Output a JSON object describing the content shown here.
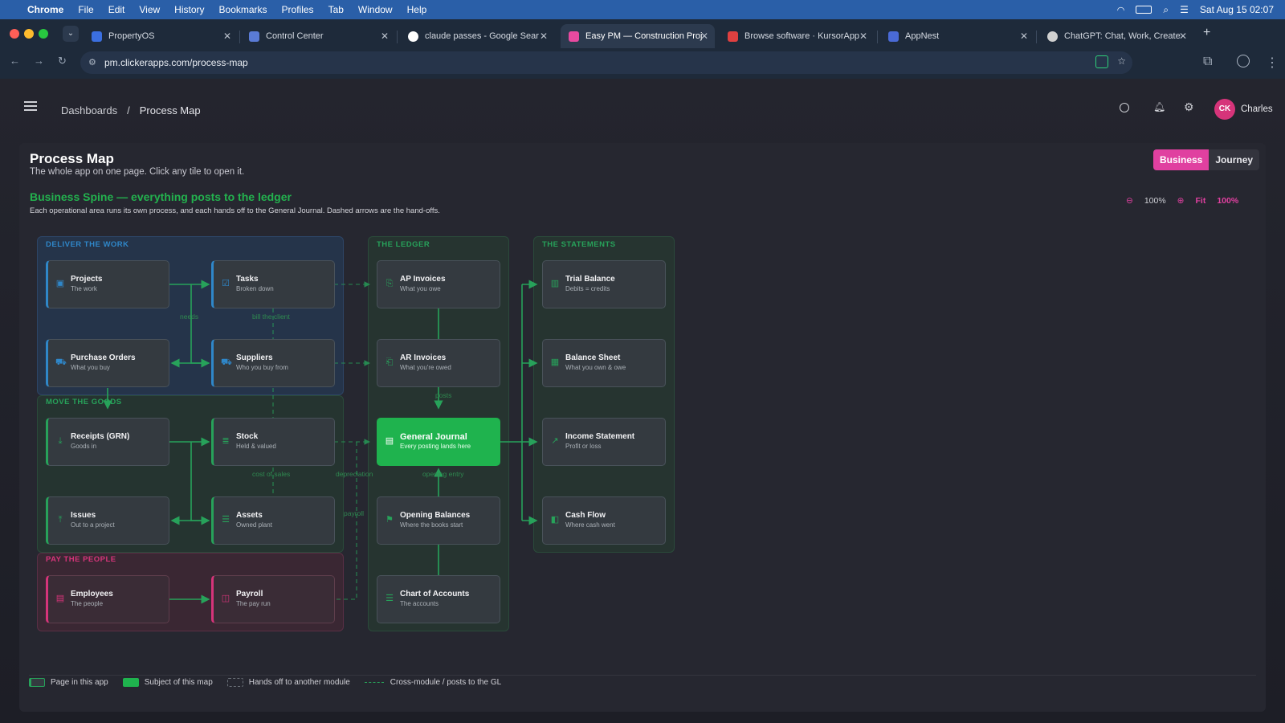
{
  "menubar": {
    "app": "Chrome",
    "items": [
      "File",
      "Edit",
      "View",
      "History",
      "Bookmarks",
      "Profiles",
      "Tab",
      "Window",
      "Help"
    ],
    "clock": "Sat Aug 15  02:07"
  },
  "tabs": [
    {
      "title": "PropertyOS",
      "color": "#3b6fe0"
    },
    {
      "title": "Control Center",
      "color": "#5a7bd6"
    },
    {
      "title": "claude passes - Google Sear",
      "color": "#ffffff"
    },
    {
      "title": "Easy PM — Construction Proj",
      "color": "#e84aa0"
    },
    {
      "title": "Browse software · KursorApp",
      "color": "#e04040"
    },
    {
      "title": "AppNest",
      "color": "#4a6ad6"
    },
    {
      "title": "ChatGPT: Chat, Work, Create",
      "color": "#d0d0d0"
    }
  ],
  "address": "pm.clickerapps.com/process-map",
  "breadcrumb": {
    "root": "Dashboards",
    "sep": "/",
    "current": "Process Map"
  },
  "user": {
    "initials": "CK",
    "name": "Charles",
    "avatar_color": "#d6347a"
  },
  "page": {
    "title": "Process Map",
    "subtitle": "The whole app on one page. Click any tile to open it.",
    "toggle": [
      "Business",
      "Journey"
    ],
    "active_toggle": "Business",
    "section_title": "Business Spine — everything posts to the ledger",
    "section_desc": "Each operational area runs its own process, and each hands off to the General Journal. Dashed arrows are the hand-offs.",
    "zoom": "100%",
    "fit": "Fit",
    "zoom2": "100%"
  },
  "groups": {
    "deliver": "DELIVER THE WORK",
    "move": "MOVE THE GOODS",
    "pay": "PAY THE PEOPLE",
    "ledger": "THE LEDGER",
    "statements": "THE STATEMENTS"
  },
  "tiles": {
    "projects": {
      "title": "Projects",
      "sub": "The work"
    },
    "tasks": {
      "title": "Tasks",
      "sub": "Broken down"
    },
    "purchase_orders": {
      "title": "Purchase Orders",
      "sub": "What you buy"
    },
    "suppliers": {
      "title": "Suppliers",
      "sub": "Who you buy from"
    },
    "receipts": {
      "title": "Receipts (GRN)",
      "sub": "Goods in"
    },
    "stock": {
      "title": "Stock",
      "sub": "Held & valued"
    },
    "issues": {
      "title": "Issues",
      "sub": "Out to a project"
    },
    "assets": {
      "title": "Assets",
      "sub": "Owned plant"
    },
    "employees": {
      "title": "Employees",
      "sub": "The people"
    },
    "payroll": {
      "title": "Payroll",
      "sub": "The pay run"
    },
    "ap_invoices": {
      "title": "AP Invoices",
      "sub": "What you owe"
    },
    "ar_invoices": {
      "title": "AR Invoices",
      "sub": "What you're owed"
    },
    "general_journal": {
      "title": "General Journal",
      "sub": "Every posting lands here"
    },
    "opening_balances": {
      "title": "Opening Balances",
      "sub": "Where the books start"
    },
    "chart_of_accounts": {
      "title": "Chart of Accounts",
      "sub": "The accounts"
    },
    "trial_balance": {
      "title": "Trial Balance",
      "sub": "Debits = credits"
    },
    "balance_sheet": {
      "title": "Balance Sheet",
      "sub": "What you own & owe"
    },
    "income_statement": {
      "title": "Income Statement",
      "sub": "Profit or loss"
    },
    "cash_flow": {
      "title": "Cash Flow",
      "sub": "Where cash went"
    }
  },
  "edge_labels": {
    "needs": "needs",
    "bill": "bill the client",
    "posts": "posts",
    "cost_of_sales": "cost of sales",
    "depreciation": "depreciation",
    "opening_entry": "opening entry",
    "payroll": "payroll"
  },
  "legend": [
    "Page in this app",
    "Subject of this map",
    "Hands off to another module",
    "Cross-module / posts to the GL"
  ],
  "colors": {
    "accent_green": "#1fb34e",
    "accent_blue": "#2f87c9",
    "accent_pink": "#d6347a",
    "toggle_active": "#e040a0"
  }
}
